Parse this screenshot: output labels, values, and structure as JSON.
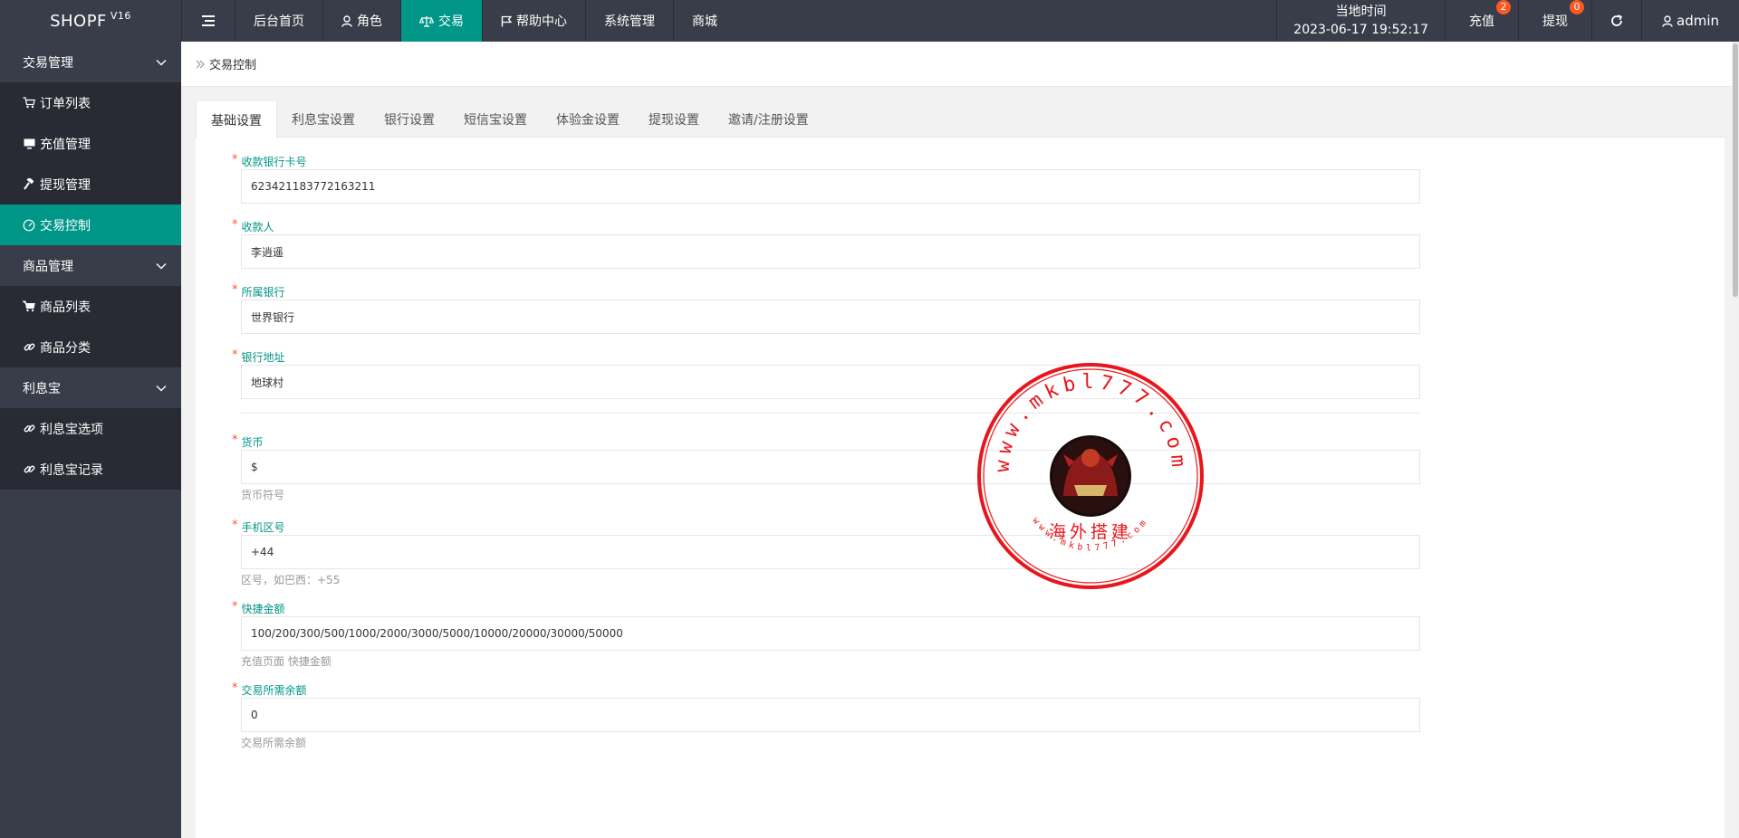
{
  "app": {
    "logo": "SHOPF",
    "version": "V16"
  },
  "topnav": [
    {
      "label": "后台首页",
      "icon": ""
    },
    {
      "label": "角色",
      "icon": "user-icon"
    },
    {
      "label": "交易",
      "icon": "scale-icon",
      "active": true
    },
    {
      "label": "帮助中心",
      "icon": "flag-icon"
    },
    {
      "label": "系统管理",
      "icon": ""
    },
    {
      "label": "商城",
      "icon": ""
    }
  ],
  "header": {
    "time_label": "当地时间",
    "time_value": "2023-06-17 19:52:17",
    "recharge_label": "充值",
    "recharge_count": "2",
    "withdraw_label": "提现",
    "withdraw_count": "0",
    "user": "admin"
  },
  "sidebar": {
    "groups": [
      {
        "label": "交易管理",
        "items": [
          "订单列表",
          "充值管理",
          "提现管理",
          "交易控制"
        ]
      },
      {
        "label": "商品管理",
        "items": [
          "商品列表",
          "商品分类"
        ]
      },
      {
        "label": "利息宝",
        "items": [
          "利息宝选项",
          "利息宝记录"
        ]
      }
    ]
  },
  "breadcrumb": "交易控制",
  "tabs": [
    "基础设置",
    "利息宝设置",
    "银行设置",
    "短信宝设置",
    "体验金设置",
    "提现设置",
    "邀请/注册设置"
  ],
  "form": {
    "bank_card": {
      "label": "收款银行卡号",
      "value": "623421183772163211"
    },
    "payee": {
      "label": "收款人",
      "value": "李逍遥"
    },
    "bank": {
      "label": "所属银行",
      "value": "世界银行"
    },
    "bank_address": {
      "label": "银行地址",
      "value": "地球村"
    },
    "currency": {
      "label": "货币",
      "value": "$",
      "help": "货币符号"
    },
    "phone_code": {
      "label": "手机区号",
      "value": "+44",
      "help": "区号，如巴西：+55"
    },
    "quick_amounts": {
      "label": "快捷金额",
      "value": "100/200/300/500/1000/2000/3000/5000/10000/20000/30000/50000",
      "help": "充值页面 快捷金额"
    },
    "min_balance": {
      "label": "交易所需余额",
      "value": "0",
      "help": "交易所需余额"
    }
  },
  "watermark": {
    "top_text": "www.mkbl777.com",
    "center_text": "海外搭建",
    "bottom_text": "www.mkbl777.com"
  },
  "colors": {
    "header_bg": "#393d49",
    "accent": "#009688",
    "badge": "#ff5722",
    "stamp": "#e8161c"
  }
}
